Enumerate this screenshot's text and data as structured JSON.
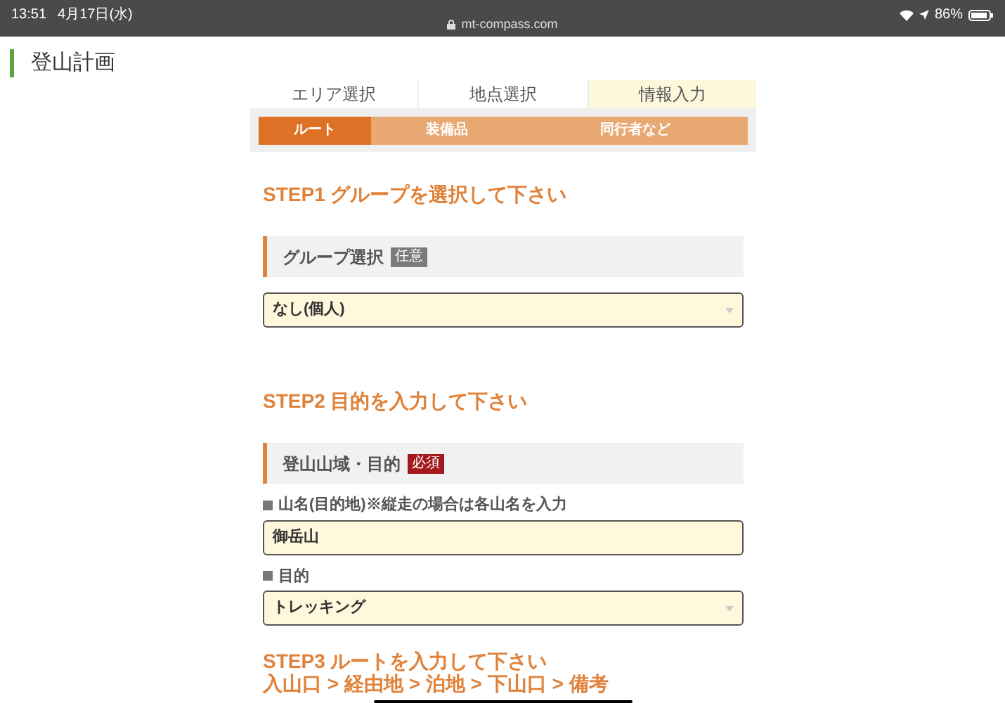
{
  "status_bar": {
    "time": "13:51",
    "date": "4月17日(水)",
    "url": "mt-compass.com",
    "battery": "86%"
  },
  "page_title": "登山計画",
  "steps": [
    {
      "label": "エリア選択",
      "selected": false
    },
    {
      "label": "地点選択",
      "selected": false
    },
    {
      "label": "情報入力",
      "selected": true
    }
  ],
  "sub_steps": [
    {
      "label": "ルート",
      "selected": true
    },
    {
      "label": "装備品",
      "selected": false
    },
    {
      "label": "同行者など",
      "selected": false
    }
  ],
  "sections": [
    {
      "heading": "STEP1 グループを選択して下さい",
      "panel": {
        "title": "グループ選択",
        "badge": {
          "text": "任意",
          "kind": "optional"
        }
      },
      "fields": [
        {
          "kind": "select",
          "value": "なし(個人)"
        }
      ]
    },
    {
      "heading": "STEP2 目的を入力して下さい",
      "panel": {
        "title": "登山山域・目的",
        "badge": {
          "text": "必須",
          "kind": "required"
        }
      },
      "fields": [
        {
          "kind": "text",
          "label": "山名(目的地)※縦走の場合は各山名を入力",
          "value": "御岳山"
        },
        {
          "kind": "select",
          "label": "目的",
          "value": "トレッキング"
        }
      ]
    }
  ],
  "step3": {
    "heading": "STEP3 ルートを入力して下さい",
    "subheading": "入山口 > 経由地 > 泊地 > 下山口 > 備考"
  }
}
